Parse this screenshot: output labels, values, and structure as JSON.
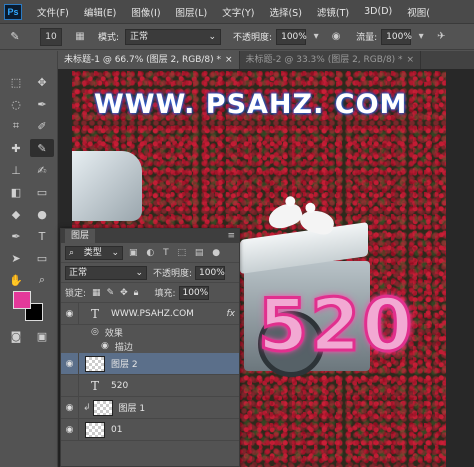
{
  "app": {
    "logo": "Ps"
  },
  "menu": [
    "文件(F)",
    "编辑(E)",
    "图像(I)",
    "图层(L)",
    "文字(Y)",
    "选择(S)",
    "滤镜(T)",
    "3D(D)",
    "视图("
  ],
  "options": {
    "brush_size": "10",
    "mode_label": "模式:",
    "mode_value": "正常",
    "opacity_label": "不透明度:",
    "opacity_value": "100%",
    "flow_label": "流量:",
    "flow_value": "100%"
  },
  "tabs": [
    {
      "label": "未标题-1 @ 66.7% (图层 2, RGB/8) *",
      "close": "×",
      "active": true
    },
    {
      "label": "未标题-2 @ 33.3% (图层 2, RGB/8) *",
      "close": "×",
      "active": false
    }
  ],
  "colors": {
    "foreground": "#e4399a",
    "background": "#000000",
    "accent": "#2a63d6"
  },
  "canvas": {
    "watermark": "WWW. PSAHZ. COM",
    "headline": "520"
  },
  "layers_panel": {
    "title": "图层",
    "filter_label": "类型",
    "blend_mode": "正常",
    "opacity_label": "不透明度:",
    "opacity_value": "100%",
    "lock_label": "锁定:",
    "fill_label": "填充:",
    "fill_value": "100%",
    "layers": [
      {
        "name": "WWW.PSAHZ.COM",
        "kind": "text",
        "visible": true,
        "fx": "fx"
      },
      {
        "name": "图层 2",
        "kind": "pixel",
        "visible": true,
        "selected": true
      },
      {
        "name": "520",
        "kind": "text",
        "visible": false
      },
      {
        "name": "图层 1",
        "kind": "pixel",
        "visible": true
      },
      {
        "name": "01",
        "kind": "pixel",
        "visible": true
      }
    ],
    "effects_label": "效果",
    "stroke_label": "描边"
  }
}
